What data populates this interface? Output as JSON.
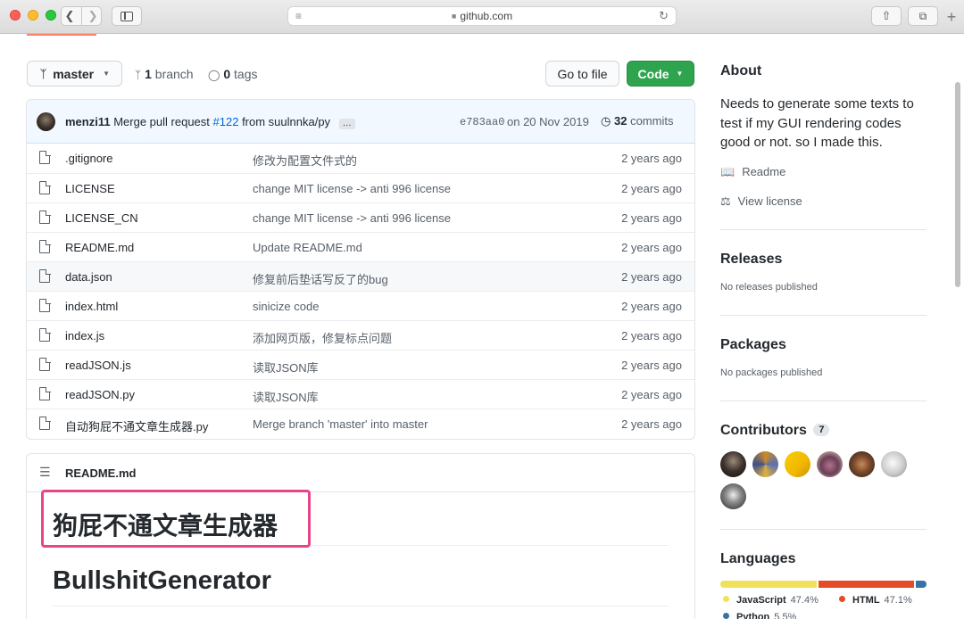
{
  "browser": {
    "url": "github.com",
    "colors": {
      "close": "#fe5f57",
      "minimize": "#febc2e",
      "maximize": "#28c840"
    }
  },
  "repo_nav": {
    "branch_name": "master",
    "branch_count": "1",
    "branch_label": "branch",
    "tag_count": "0",
    "tag_label": "tags",
    "go_to_file": "Go to file",
    "code_button": "Code"
  },
  "commit": {
    "author": "menzi11",
    "message_prefix": "Merge pull request",
    "pr_link": "#122",
    "message_suffix": "from suulnnka/py",
    "ellipsis": "…",
    "hash": "e783aa0",
    "date": "on 20 Nov 2019",
    "commit_count": "32",
    "commit_label": "commits"
  },
  "files": [
    {
      "name": ".gitignore",
      "message": "修改为配置文件式的",
      "age": "2 years ago"
    },
    {
      "name": "LICENSE",
      "message": "change MIT license -> anti 996 license",
      "age": "2 years ago"
    },
    {
      "name": "LICENSE_CN",
      "message": "change MIT license -> anti 996 license",
      "age": "2 years ago"
    },
    {
      "name": "README.md",
      "message": "Update README.md",
      "age": "2 years ago"
    },
    {
      "name": "data.json",
      "message": "修复前后垫话写反了的bug",
      "age": "2 years ago"
    },
    {
      "name": "index.html",
      "message": "sinicize code",
      "age": "2 years ago"
    },
    {
      "name": "index.js",
      "message": "添加网页版，修复标点问题",
      "age": "2 years ago"
    },
    {
      "name": "readJSON.js",
      "message": "读取JSON库",
      "age": "2 years ago"
    },
    {
      "name": "readJSON.py",
      "message": "读取JSON库",
      "age": "2 years ago"
    },
    {
      "name": "自动狗屁不通文章生成器.py",
      "message": "Merge branch 'master' into master",
      "age": "2 years ago"
    }
  ],
  "readme": {
    "filename": "README.md",
    "heading_cn": "狗屁不通文章生成器",
    "heading_en": "BullshitGenerator"
  },
  "sidebar": {
    "about_title": "About",
    "about_text_1": "Needs to generate some texts to",
    "about_text_2": "test if my GUI rendering codes",
    "about_text_3": "good or not. so I made this.",
    "readme_link": "Readme",
    "license_link": "View license",
    "releases_title": "Releases",
    "releases_text": "No releases published",
    "packages_title": "Packages",
    "packages_text": "No packages published",
    "contributors_title": "Contributors",
    "contributors_count": "7",
    "languages_title": "Languages",
    "languages": [
      {
        "name": "JavaScript",
        "percent": "47.4%",
        "value": 47.4,
        "color": "#f1e05a"
      },
      {
        "name": "HTML",
        "percent": "47.1%",
        "value": 47.1,
        "color": "#e34c26"
      },
      {
        "name": "Python",
        "percent": "5.5%",
        "value": 5.5,
        "color": "#3572a5"
      }
    ]
  }
}
